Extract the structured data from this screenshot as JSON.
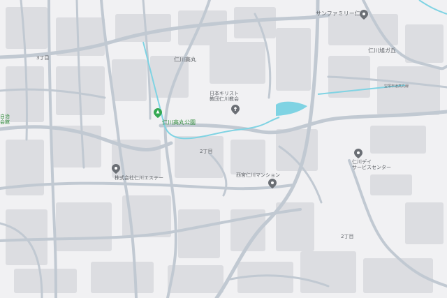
{
  "map": {
    "labels": {
      "family_mart": "サンファミリー仁川",
      "jinkawa_asahigaoka": "仁川旭ガ丘",
      "takamaru_top": "仁川高丸",
      "church": "日本キリスト\n教団仁川教会",
      "park": "仁川高丸公園",
      "nichome_mid": "2丁目",
      "sanchome": "3丁目",
      "company": "株式会社仁川エステー",
      "mansion": "西宮仁川マンション",
      "service_center": "仁川デイ\nサービスセンター",
      "nichome_bottom": "2丁目",
      "left_edge": "自治\n会館",
      "road_small": "宝塚市道高丸線"
    },
    "colors": {
      "background": "#f1f1f3",
      "block": "#dcdde1",
      "road": "#c1c9d2",
      "water": "#7fd3e3",
      "pin_gray": "#6b6f75",
      "pin_green": "#34a853"
    },
    "icons": [
      "place-pin-icon",
      "park-pin-icon"
    ]
  }
}
